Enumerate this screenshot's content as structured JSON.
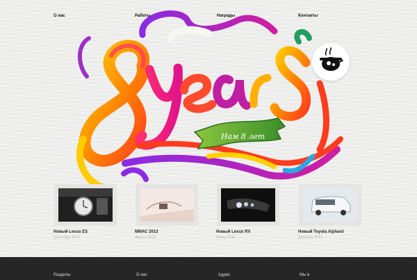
{
  "nav": {
    "items": [
      "О нас",
      "Работы",
      "Награды",
      "Контакты"
    ]
  },
  "hero": {
    "ribbon_text": "Нам 8 лет"
  },
  "news": [
    {
      "title": "Новый Lexus ES",
      "date": "Сентябрь 2012"
    },
    {
      "title": "ММАС 2012",
      "date": "Август 2012"
    },
    {
      "title": "Новый Lexus RX",
      "date": "Июнь 2012"
    },
    {
      "title": "Новый Toyota Alphard",
      "date": "Декабрь 2011"
    }
  ],
  "footer": {
    "items": [
      "Разделы",
      "О нас",
      "Адрес",
      "Мы в"
    ]
  },
  "colors": {
    "footer_bg": "#262626",
    "background": "#eeeeec"
  },
  "icons": {
    "logo": "steaming-pot-logo-icon"
  }
}
